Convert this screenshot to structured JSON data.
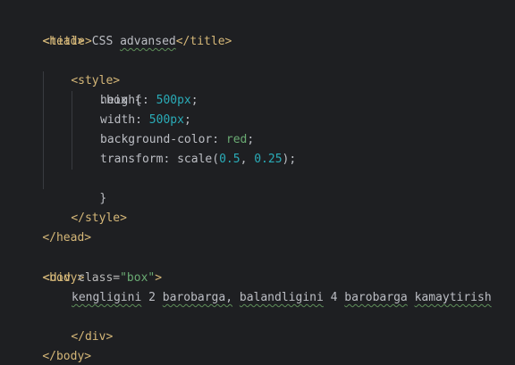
{
  "code": {
    "head_open": "<head>",
    "title_open": "<title>",
    "title_text_a": "CSS",
    "title_text_b": "advansed",
    "title_close": "</title>",
    "style_open": "<style>",
    "selector": ".box {",
    "height_prop": "height:",
    "height_val": "500px",
    "width_prop": "width:",
    "width_val": "500px",
    "bg_prop": "background-color:",
    "bg_val": "red",
    "transform_prop": "transform:",
    "transform_fn": "scale(",
    "scale_x": "0.5",
    "scale_sep": ", ",
    "scale_y": "0.25",
    "transform_end": ");",
    "semicolon": ";",
    "brace_close": "}",
    "style_close": "</style>",
    "head_close": "</head>",
    "body_open": "<body>",
    "div_open_start": "<div",
    "div_attr": "class=",
    "div_attr_val": "\"box\"",
    "div_open_end": ">",
    "div_words": [
      "kengligini",
      "2",
      "barobarga,",
      "balandligini",
      "4",
      "barobarga",
      "kamaytirish"
    ],
    "div_close": "</div>",
    "body_close": "</body>"
  }
}
